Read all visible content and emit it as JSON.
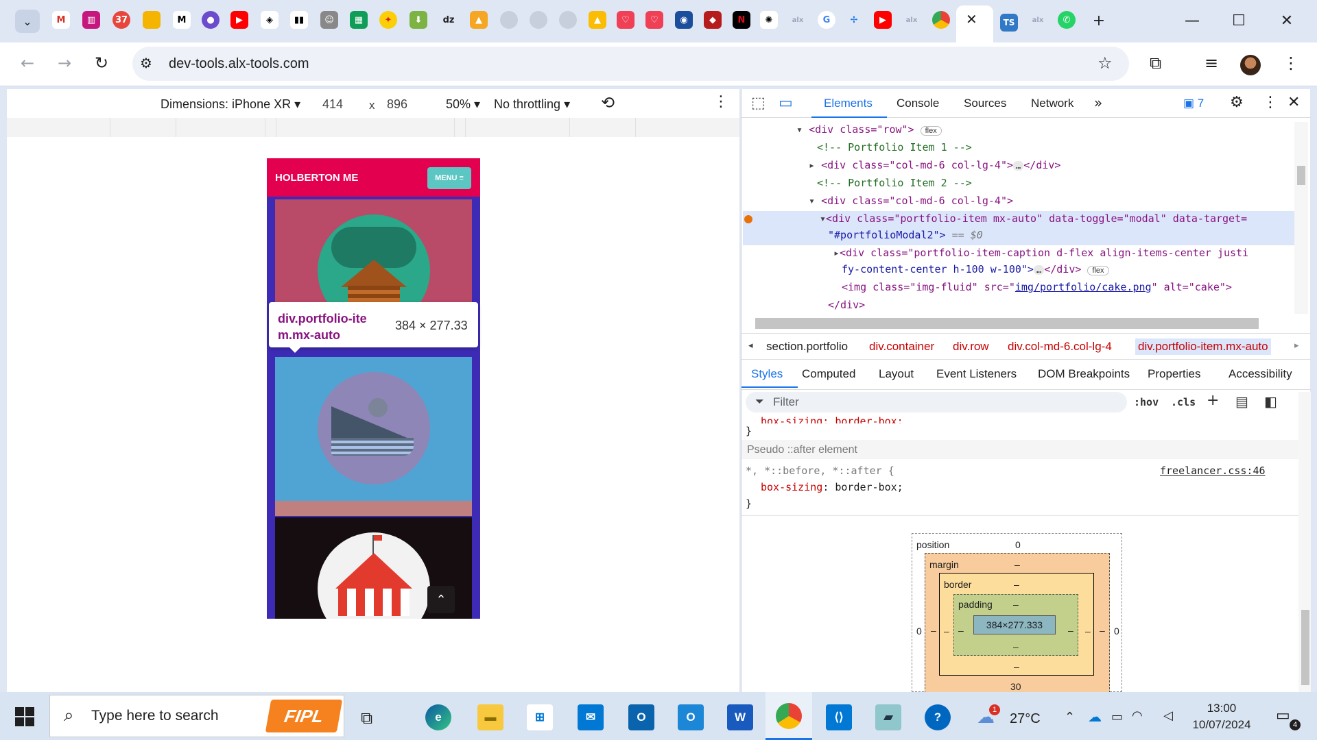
{
  "browser": {
    "url": "dev-tools.alx-tools.com",
    "tab_badge_count": "37",
    "tab_ts": "TS"
  },
  "device_toolbar": {
    "dimensions": "Dimensions: iPhone XR",
    "width": "414",
    "times": "x",
    "height": "896",
    "zoom": "50%",
    "throttling": "No throttling"
  },
  "page": {
    "brand": "HOLBERTON ME",
    "menu_label": "MENU ≡",
    "tooltip_selector": "div.portfolio-item.mx-auto",
    "tooltip_selector_line1": "div.portfolio-ite",
    "tooltip_selector_line2": "m.mx-auto",
    "tooltip_size": "384 × 277.33"
  },
  "devtools": {
    "tabs": [
      "Elements",
      "Console",
      "Sources",
      "Network"
    ],
    "issues_count": "7",
    "dom_lines": [
      {
        "t": "<div class=\"row\">",
        "badge": "flex"
      },
      {
        "t": "<!-- Portfolio Item 1 -->"
      },
      {
        "t": "<div class=\"col-md-6 col-lg-4\">",
        "tail": "</div>"
      },
      {
        "t": "<!-- Portfolio Item 2 -->"
      },
      {
        "t": "<div class=\"col-md-6 col-lg-4\">"
      },
      {
        "t": "<div class=\"portfolio-item mx-auto\" data-toggle=\"modal\" data-target=",
        "t2": "\"#portfolioModal2\">",
        "eq": "== $0"
      },
      {
        "t": "<div class=\"portfolio-item-caption d-flex align-items-center justi",
        "t2": "fy-content-center h-100 w-100\">",
        "tail": "</div>",
        "badge": "flex"
      },
      {
        "t": "<img class=\"img-fluid\" src=\"",
        "link": "img/portfolio/cake.png",
        "t3": "\" alt=\"cake\">"
      },
      {
        "t": "</div>"
      }
    ],
    "breadcrumbs": [
      "section.portfolio",
      "div.container",
      "div.row",
      "div.col-md-6.col-lg-4",
      "div.portfolio-item.mx-auto"
    ],
    "subtabs": [
      "Styles",
      "Computed",
      "Layout",
      "Event Listeners",
      "DOM Breakpoints",
      "Properties",
      "Accessibility"
    ],
    "filter_placeholder": "Filter",
    "hov": ":hov",
    "cls": ".cls",
    "style_cut_line": "box-sizing: border-box;",
    "close_brace": "}",
    "pseudo_header": "Pseudo ::after element",
    "rule_selector": "*, *::before, *::after {",
    "rule_prop": "box-sizing",
    "rule_value": "border-box;",
    "rule_source": "freelancer.css:46",
    "box_model": {
      "position_label": "position",
      "position_val": "0",
      "margin_label": "margin",
      "border_label": "border",
      "padding_label": "padding",
      "content": "384×277.333",
      "dash": "–",
      "left_val": "0",
      "right_val": "0",
      "bottom_val": "30"
    }
  },
  "taskbar": {
    "search_placeholder": "Type here to search",
    "fipl": "FIPL",
    "temperature": "27°C",
    "time": "13:00",
    "date": "10/07/2024",
    "notifications": "4",
    "weather_badge": "1"
  },
  "colors": {
    "accent_blue": "#1a73e8",
    "brand_red": "#e3004f",
    "phone_purple": "#3d2bb6",
    "selected_row": "#dbe6fb"
  }
}
